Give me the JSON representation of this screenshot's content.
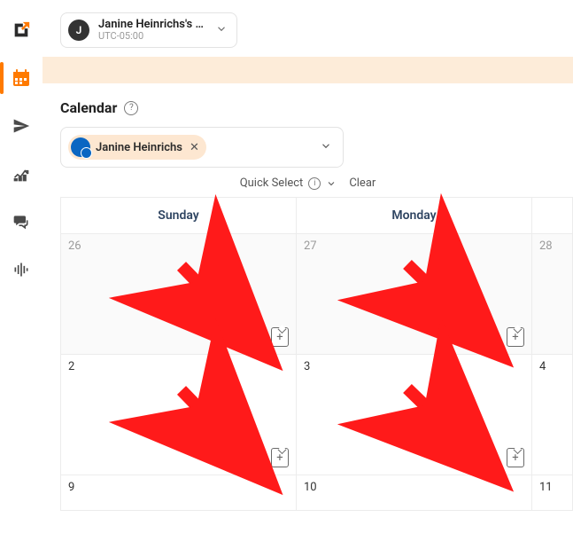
{
  "account": {
    "initial": "J",
    "name": "Janine Heinrichs's …",
    "timezone": "UTC-05:00"
  },
  "page": {
    "title": "Calendar"
  },
  "filter": {
    "person": "Janine Heinrichs"
  },
  "toolbar": {
    "quick_select": "Quick Select",
    "clear": "Clear"
  },
  "calendar": {
    "days": [
      "Sunday",
      "Monday"
    ],
    "rows": [
      {
        "cells": [
          {
            "n": "26",
            "prev": true,
            "add": true
          },
          {
            "n": "27",
            "prev": true,
            "add": true
          },
          {
            "n": "28",
            "prev": true,
            "add": false,
            "partial": true
          }
        ]
      },
      {
        "cells": [
          {
            "n": "2",
            "prev": false,
            "add": true
          },
          {
            "n": "3",
            "prev": false,
            "add": true
          },
          {
            "n": "4",
            "prev": false,
            "add": false,
            "partial": true
          }
        ]
      },
      {
        "short": true,
        "cells": [
          {
            "n": "9",
            "prev": false,
            "add": false
          },
          {
            "n": "10",
            "prev": false,
            "add": false
          },
          {
            "n": "11",
            "prev": false,
            "add": false,
            "partial": true
          }
        ]
      }
    ]
  },
  "annotation_color": "#ff1a1a"
}
